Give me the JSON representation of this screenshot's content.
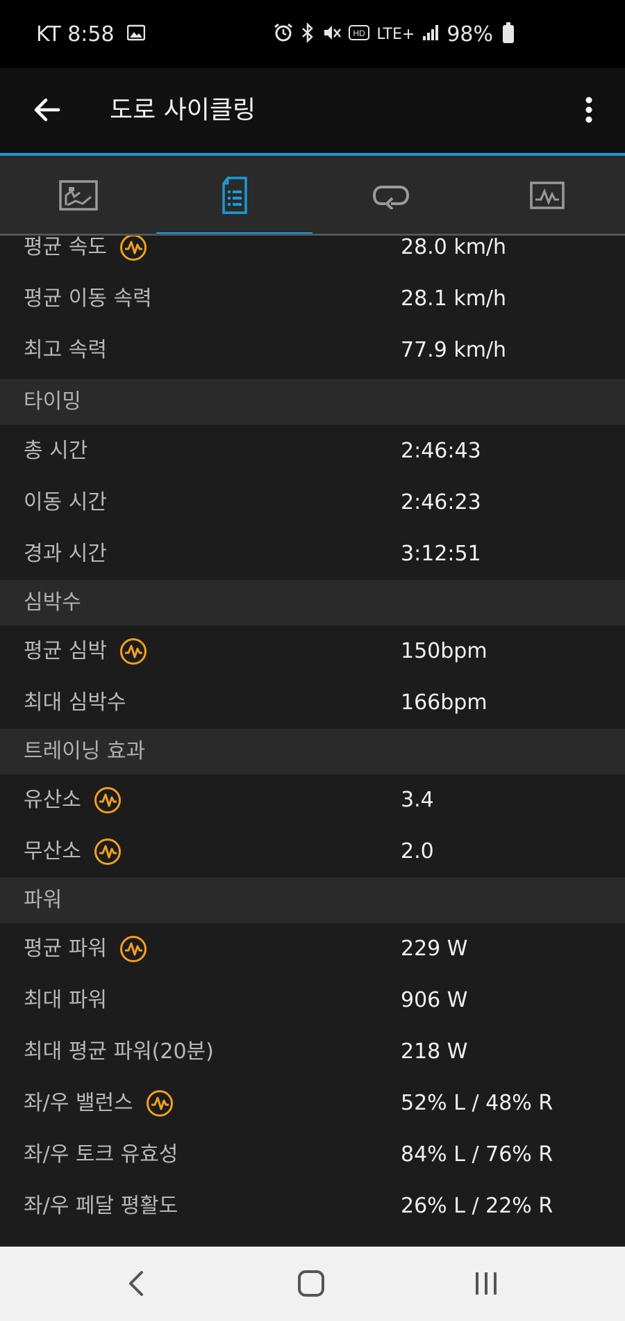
{
  "status_bar": {
    "carrier_time": "KT 8:58",
    "network": "LTE+",
    "battery": "98%",
    "icons": [
      "gallery-icon",
      "alarm-icon",
      "bluetooth-icon",
      "mute-icon",
      "hd-icon",
      "lte-icon",
      "signal-icon",
      "battery-icon"
    ]
  },
  "app_bar": {
    "title": "도로 사이클링"
  },
  "tabs": [
    {
      "name": "overview-tab",
      "icon": "map-image-icon",
      "active": false
    },
    {
      "name": "stats-tab",
      "icon": "document-list-icon",
      "active": true
    },
    {
      "name": "laps-tab",
      "icon": "loop-icon",
      "active": false
    },
    {
      "name": "charts-tab",
      "icon": "graph-icon",
      "active": false
    }
  ],
  "colors": {
    "accent": "#1a9ad6",
    "badge": "#f0a020",
    "background": "#1c1c1c",
    "section": "#2a2a2a"
  },
  "rows": {
    "avg_speed": {
      "label": "평균 속도",
      "value": "28.0 km/h"
    },
    "avg_moving_speed": {
      "label": "평균 이동 속력",
      "value": "28.1 km/h"
    },
    "max_speed": {
      "label": "최고 속력",
      "value": "77.9 km/h"
    },
    "section_timing": "타이밍",
    "total_time": {
      "label": "총 시간",
      "value": "2:46:43"
    },
    "moving_time": {
      "label": "이동 시간",
      "value": "2:46:23"
    },
    "elapsed_time": {
      "label": "경과 시간",
      "value": "3:12:51"
    },
    "section_hr": "심박수",
    "avg_hr": {
      "label": "평균 심박",
      "value": "150bpm"
    },
    "max_hr": {
      "label": "최대 심박수",
      "value": "166bpm"
    },
    "section_training": "트레이닝 효과",
    "aerobic": {
      "label": "유산소",
      "value": "3.4"
    },
    "anaerobic": {
      "label": "무산소",
      "value": "2.0"
    },
    "section_power": "파워",
    "avg_power": {
      "label": "평균 파워",
      "value": "229 W"
    },
    "max_power": {
      "label": "최대 파워",
      "value": "906 W"
    },
    "max_avg_power_20": {
      "label": "최대 평균 파워(20분)",
      "value": "218 W"
    },
    "lr_balance": {
      "label": "좌/우 밸런스",
      "value": "52% L / 48% R"
    },
    "lr_torque": {
      "label": "좌/우 토크 유효성",
      "value": "84% L / 76% R"
    },
    "lr_smoothness": {
      "label": "좌/우 페달 평활도",
      "value": "26% L / 22% R"
    }
  },
  "nav_bar": {
    "buttons": [
      "back-nav-icon",
      "home-nav-icon",
      "recent-apps-icon"
    ]
  }
}
